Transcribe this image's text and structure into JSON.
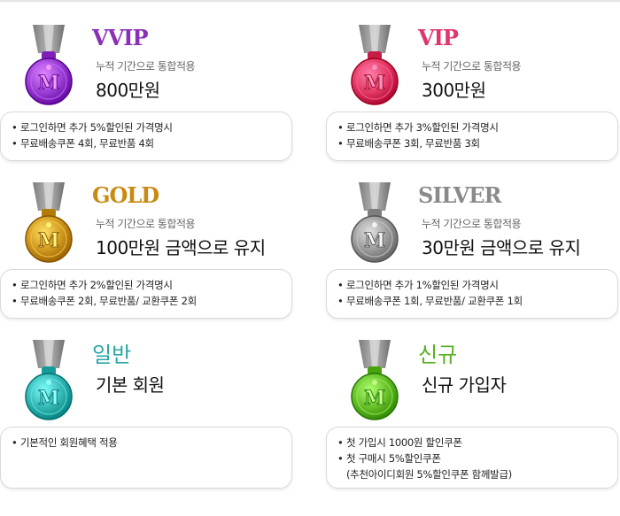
{
  "tiers": {
    "vvip": {
      "name": "VVIP",
      "sub": "누적 기간으로 통합적용",
      "amount": "800만원",
      "color": "#8a2fb8",
      "medal_color": "#9b3fd6",
      "benefits": [
        "로그인하면 추가 5%할인된 가격명시",
        "무료배송쿠폰 4회, 무료반품 4회"
      ]
    },
    "vip": {
      "name": "VIP",
      "sub": "누적 기간으로 통합적용",
      "amount": "300만원",
      "color": "#e0356a",
      "medal_color": "#e43a66",
      "benefits": [
        "로그인하면 추가 3%할인된 가격명시",
        "무료배송쿠폰 3회, 무료반품 3회"
      ]
    },
    "gold": {
      "name": "GOLD",
      "sub": "누적 기간으로 통합적용",
      "amount": "100만원 금액으로 유지",
      "color": "#c98a12",
      "medal_color": "#d19a1f",
      "benefits": [
        "로그인하면 추가 2%할인된 가격명시",
        "무료배송쿠폰 2회, 무료반품/ 교환쿠폰 2회"
      ]
    },
    "silver": {
      "name": "SILVER",
      "sub": "누적 기간으로 통합적용",
      "amount": "30만원 금액으로 유지",
      "color": "#8a8a8a",
      "medal_color": "#9c9c9c",
      "benefits": [
        "로그인하면 추가 1%할인된 가격명시",
        "무료배송쿠폰 1회, 무료반품/ 교환쿠폰 1회"
      ]
    },
    "general": {
      "name": "일반",
      "amount": "기본 회원",
      "color": "#2aa6a6",
      "medal_color": "#36b9b6",
      "benefits": [
        "기본적인 회원혜택 적용"
      ]
    },
    "new": {
      "name": "신규",
      "amount": "신규 가입자",
      "color": "#58b01f",
      "medal_color": "#68c02a",
      "benefits": [
        "첫 가입시 1000원 할인쿠폰",
        "첫 구매시 5%할인쿠폰"
      ],
      "benefit_note": "(추천아이디회원 5%할인쿠폰 함께발급)"
    }
  },
  "medal_letter": "M"
}
